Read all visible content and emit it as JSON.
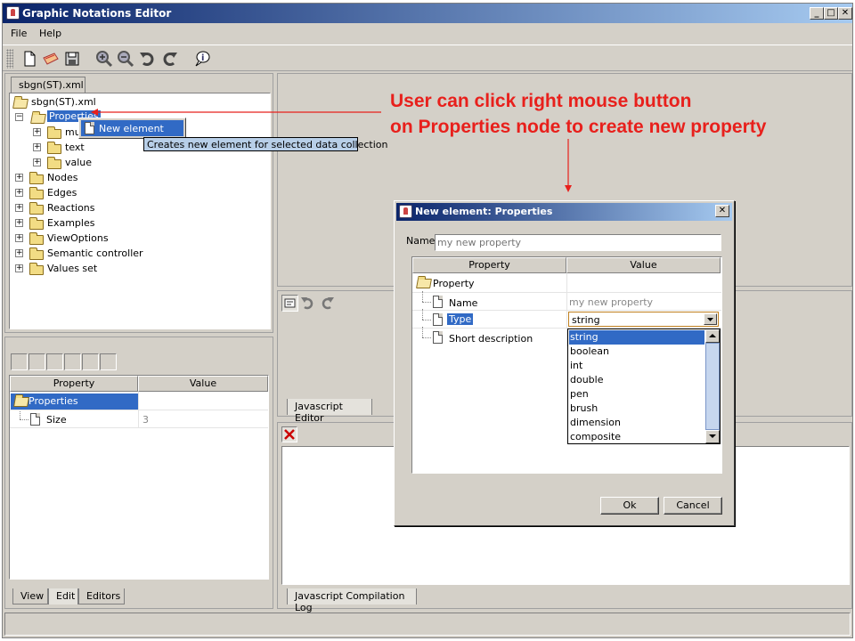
{
  "window": {
    "title": "Graphic Notations Editor",
    "min": "_",
    "max": "□",
    "close": "✕"
  },
  "menu": {
    "file": "File",
    "help": "Help"
  },
  "toolbar": {
    "icons": [
      "new-file-icon",
      "open-icon",
      "save-icon",
      "zoom-in-icon",
      "zoom-out-icon",
      "undo-icon",
      "redo-icon",
      "info-icon"
    ]
  },
  "left_top": {
    "tab": "sbgn(ST).xml",
    "tree": {
      "root": "sbgn(ST).xml",
      "properties": "Properties",
      "children": [
        "mul",
        "text",
        "value"
      ],
      "nodes": [
        "Nodes",
        "Edges",
        "Reactions",
        "Examples",
        "ViewOptions",
        "Semantic controller",
        "Values set"
      ]
    },
    "context_menu": {
      "item": "New element",
      "tooltip": "Creates new element for selected data collection"
    }
  },
  "left_bottom": {
    "headers": {
      "property": "Property",
      "value": "Value"
    },
    "rows": [
      {
        "name": "Properties",
        "value": ""
      },
      {
        "name": "Size",
        "value": "3"
      }
    ],
    "tabs": [
      "View",
      "Edit",
      "Editors"
    ]
  },
  "right": {
    "js_editor_tab": "Javascript Editor",
    "js_log_tab": "Javascript Compilation Log"
  },
  "annotation": {
    "line1": "User can click right mouse button",
    "line2": "on Properties node to create new property"
  },
  "dialog": {
    "title": "New element: Properties",
    "close": "✕",
    "name_label": "Name",
    "name_placeholder": "my new property",
    "headers": {
      "property": "Property",
      "value": "Value"
    },
    "root": "Property",
    "rows": [
      {
        "name": "Name",
        "value": "my new property"
      },
      {
        "name": "Type",
        "value": "string"
      },
      {
        "name": "Short description",
        "value": ""
      }
    ],
    "type_options": [
      "string",
      "boolean",
      "int",
      "double",
      "pen",
      "brush",
      "dimension",
      "composite"
    ],
    "ok": "Ok",
    "cancel": "Cancel"
  },
  "colors": {
    "selection": "#316ac5",
    "annotation": "#e8201c",
    "title_start": "#0a246a",
    "title_end": "#a6caf0"
  }
}
